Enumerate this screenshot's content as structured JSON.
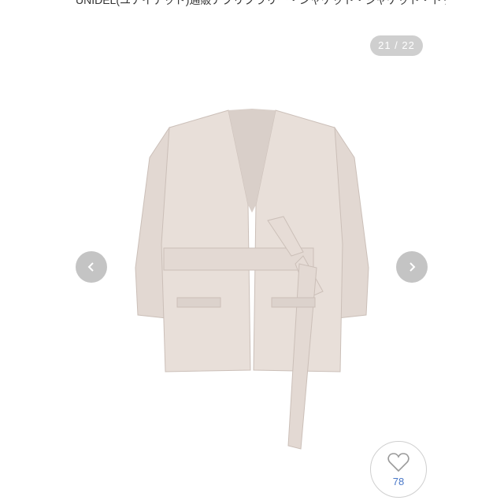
{
  "header": {
    "title": "UNIDEL(ユナイテッド)通販アクリクラリー・シャケット・ジャケット・トップス"
  },
  "gallery": {
    "counter": "21 / 22",
    "prev_icon": "chevron-left-icon",
    "next_icon": "chevron-right-icon"
  },
  "favorite": {
    "icon": "heart-icon",
    "count": "78"
  },
  "colors": {
    "jacket": "#e6ddd7",
    "nav_bg": "#c4c4c4",
    "counter_bg": "#cfcfcf",
    "count_text": "#4a78c8"
  }
}
